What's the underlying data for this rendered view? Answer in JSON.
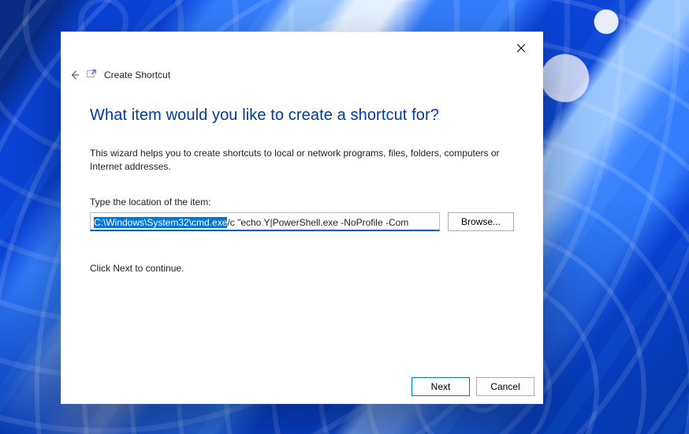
{
  "window": {
    "title": "Create Shortcut"
  },
  "page": {
    "heading": "What item would you like to create a shortcut for?",
    "description": "This wizard helps you to create shortcuts to local or network programs, files, folders, computers or Internet addresses.",
    "location_label": "Type the location of the item:",
    "location_value_selected": "C:\\Windows\\System32\\cmd.exe",
    "location_value_rest": " /c \"echo Y|PowerShell.exe -NoProfile -Com",
    "location_value_full": "C:\\Windows\\System32\\cmd.exe /c \"echo Y|PowerShell.exe -NoProfile -Com",
    "browse_label": "Browse...",
    "continue_hint": "Click Next to continue."
  },
  "buttons": {
    "next": "Next",
    "cancel": "Cancel"
  },
  "icons": {
    "close": "close-icon",
    "back": "back-arrow-icon",
    "app": "shortcut-wizard-icon"
  }
}
